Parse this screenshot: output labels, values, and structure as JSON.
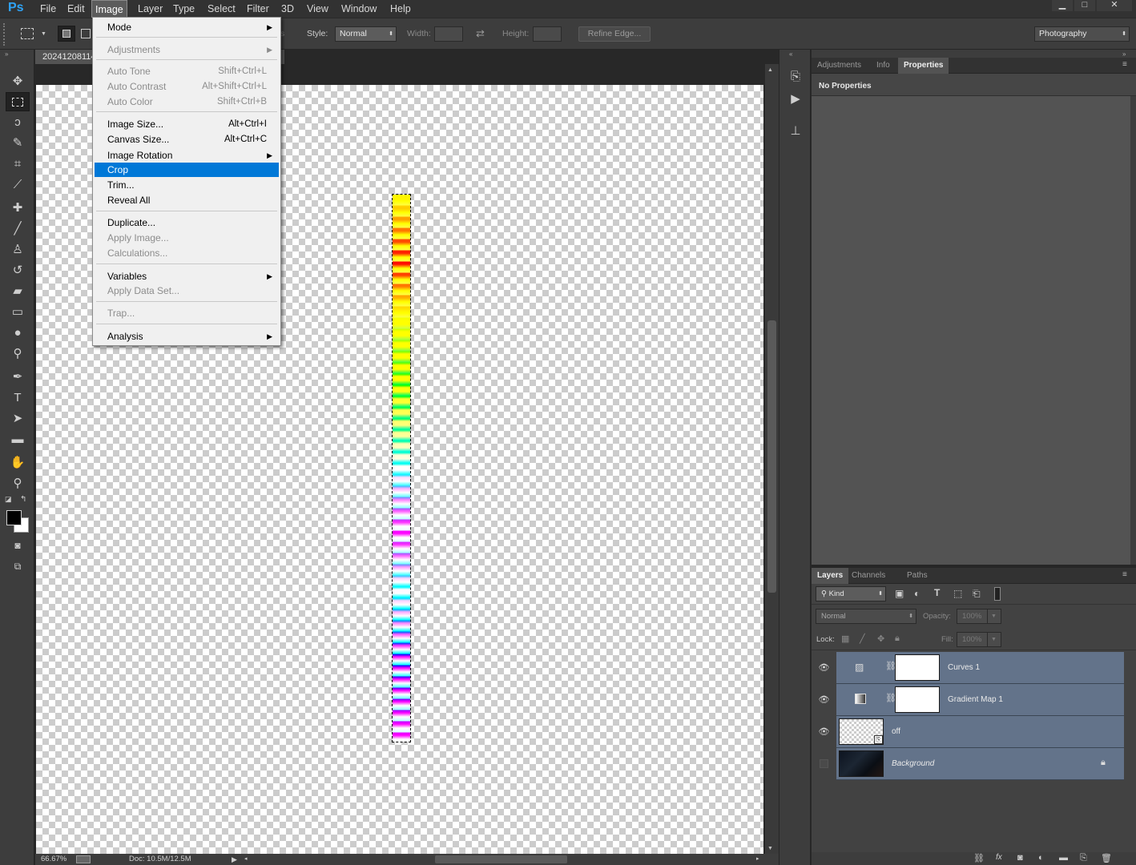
{
  "app": {
    "logo": "Ps"
  },
  "menubar": {
    "items": [
      "File",
      "Edit",
      "Image",
      "Layer",
      "Type",
      "Select",
      "Filter",
      "3D",
      "View",
      "Window",
      "Help"
    ],
    "window_controls": [
      "▁",
      "□",
      "✕"
    ]
  },
  "options_bar": {
    "style_label": "Style:",
    "style_value": "Normal",
    "width_label": "Width:",
    "height_label": "Height:",
    "refine_edge": "Refine Edge...",
    "workspace": "Photography",
    "hidden_label_fragment": "s"
  },
  "document": {
    "tab_title": "20241208114",
    "zoom": "66.67%",
    "doc_size": "Doc: 10.5M/12.5M"
  },
  "image_menu": {
    "items": [
      {
        "label": "Mode",
        "shortcut": "",
        "submenu": true,
        "disabled": false,
        "selected": false
      },
      {
        "label": "Adjustments",
        "shortcut": "",
        "submenu": true,
        "disabled": true,
        "selected": false
      },
      {
        "label": "Auto Tone",
        "shortcut": "Shift+Ctrl+L",
        "submenu": false,
        "disabled": true,
        "selected": false
      },
      {
        "label": "Auto Contrast",
        "shortcut": "Alt+Shift+Ctrl+L",
        "submenu": false,
        "disabled": true,
        "selected": false
      },
      {
        "label": "Auto Color",
        "shortcut": "Shift+Ctrl+B",
        "submenu": false,
        "disabled": true,
        "selected": false
      },
      {
        "label": "Image Size...",
        "shortcut": "Alt+Ctrl+I",
        "submenu": false,
        "disabled": false,
        "selected": false
      },
      {
        "label": "Canvas Size...",
        "shortcut": "Alt+Ctrl+C",
        "submenu": false,
        "disabled": false,
        "selected": false
      },
      {
        "label": "Image Rotation",
        "shortcut": "",
        "submenu": true,
        "disabled": false,
        "selected": false
      },
      {
        "label": "Crop",
        "shortcut": "",
        "submenu": false,
        "disabled": false,
        "selected": true
      },
      {
        "label": "Trim...",
        "shortcut": "",
        "submenu": false,
        "disabled": false,
        "selected": false
      },
      {
        "label": "Reveal All",
        "shortcut": "",
        "submenu": false,
        "disabled": false,
        "selected": false
      },
      {
        "label": "Duplicate...",
        "shortcut": "",
        "submenu": false,
        "disabled": false,
        "selected": false
      },
      {
        "label": "Apply Image...",
        "shortcut": "",
        "submenu": false,
        "disabled": true,
        "selected": false
      },
      {
        "label": "Calculations...",
        "shortcut": "",
        "submenu": false,
        "disabled": true,
        "selected": false
      },
      {
        "label": "Variables",
        "shortcut": "",
        "submenu": true,
        "disabled": false,
        "selected": false
      },
      {
        "label": "Apply Data Set...",
        "shortcut": "",
        "submenu": false,
        "disabled": true,
        "selected": false
      },
      {
        "label": "Trap...",
        "shortcut": "",
        "submenu": false,
        "disabled": true,
        "selected": false
      },
      {
        "label": "Analysis",
        "shortcut": "",
        "submenu": true,
        "disabled": false,
        "selected": false
      }
    ]
  },
  "tools": [
    "move-icon",
    "rectangular-marquee-icon",
    "lasso-icon",
    "quick-selection-icon",
    "crop-icon",
    "eyedropper-icon",
    "healing-brush-icon",
    "brush-icon",
    "clone-stamp-icon",
    "history-brush-icon",
    "eraser-icon",
    "gradient-icon",
    "blur-icon",
    "dodge-icon",
    "pen-icon",
    "type-icon",
    "path-selection-icon",
    "rectangle-shape-icon",
    "hand-icon",
    "zoom-icon"
  ],
  "properties_panel": {
    "tabs": [
      "Adjustments",
      "Info",
      "Properties"
    ],
    "active_tab": "Properties",
    "content": "No Properties"
  },
  "layers_panel": {
    "tabs": [
      "Layers",
      "Channels",
      "Paths"
    ],
    "active_tab": "Layers",
    "filter_kind": "Kind",
    "blend_mode": "Normal",
    "opacity_label": "Opacity:",
    "opacity_value": "100%",
    "lock_label": "Lock:",
    "fill_label": "Fill:",
    "fill_value": "100%",
    "layers": [
      {
        "name": "Curves 1",
        "visible": true,
        "type": "adjustment",
        "adjustment_icon": "curves-icon"
      },
      {
        "name": "Gradient Map 1",
        "visible": true,
        "type": "adjustment",
        "adjustment_icon": "gradient-map-icon"
      },
      {
        "name": "off",
        "visible": true,
        "type": "smart-object"
      },
      {
        "name": "Background",
        "visible": false,
        "type": "background",
        "locked": true
      }
    ]
  },
  "colors": {
    "accent": "#0078d7",
    "layer_selected": "#63738a"
  }
}
